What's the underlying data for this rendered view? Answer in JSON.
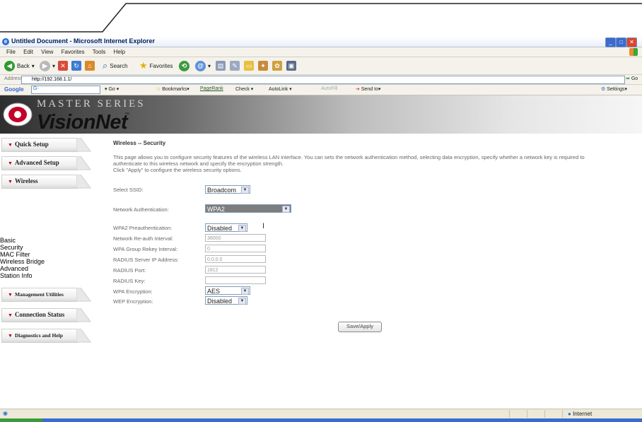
{
  "window": {
    "title": "Untitled Document - Microsoft Internet Explorer"
  },
  "menubar": [
    "File",
    "Edit",
    "View",
    "Favorites",
    "Tools",
    "Help"
  ],
  "toolbar": {
    "back": "Back",
    "search": "Search",
    "favorites": "Favorites"
  },
  "address": {
    "label": "Address",
    "url": "http://192.168.1.1/",
    "go": "Go"
  },
  "googlebar": {
    "logo": "Google",
    "input_prefix": "G-",
    "go": "Go",
    "bookmarks": "Bookmarks▾",
    "pagerank": "PageRank",
    "check": "Check ▾",
    "autolink": "AutoLink ▾",
    "autofill": "AutoFill",
    "sendto": "Send to▾",
    "settings": "Settings▾"
  },
  "banner": {
    "series": "MASTER SERIES",
    "brand": "VisionNet",
    "tm": "™"
  },
  "sidebar": {
    "nav": [
      {
        "label": "Quick Setup"
      },
      {
        "label": "Advanced Setup"
      },
      {
        "label": "Wireless"
      },
      {
        "label": "Management Utilities"
      },
      {
        "label": "Connection Status"
      },
      {
        "label": "Diagnostics and Help"
      }
    ],
    "wireless_links": [
      "Basic",
      "Security",
      "MAC Filter",
      "Wireless Bridge",
      "Advanced",
      "Station Info"
    ]
  },
  "main": {
    "heading": "Wireless -- Security",
    "description": "This page allows you to configure security features of the wireless LAN interface. You can sets the network authentication method, selecting data encryption, specify whether a network key is required to authenticate to this wireless network and specify the encryption strength.\nClick \"Apply\" to configure the wireless security options.",
    "fields": {
      "ssid": {
        "label": "Select SSID:",
        "value": "Broadcom"
      },
      "auth": {
        "label": "Network Authentication:",
        "value": "WPA2"
      },
      "preauth": {
        "label": "WPA2 Preauthentication:",
        "value": "Disabled"
      },
      "reauth": {
        "label": "Network Re-auth Interval:",
        "value": "36000"
      },
      "rekey": {
        "label": "WPA Group Rekey Interval:",
        "value": "0"
      },
      "radius_ip": {
        "label": "RADIUS Server IP Address:",
        "value": "0.0.0.0"
      },
      "radius_port": {
        "label": "RADIUS Port:",
        "value": "1812"
      },
      "radius_key": {
        "label": "RADIUS Key:",
        "value": ""
      },
      "wpa_enc": {
        "label": "WPA Encryption:",
        "value": "AES"
      },
      "wep_enc": {
        "label": "WEP Encryption:",
        "value": "Disabled"
      }
    },
    "save_label": "Save/Apply"
  },
  "status": {
    "zone": "Internet"
  }
}
